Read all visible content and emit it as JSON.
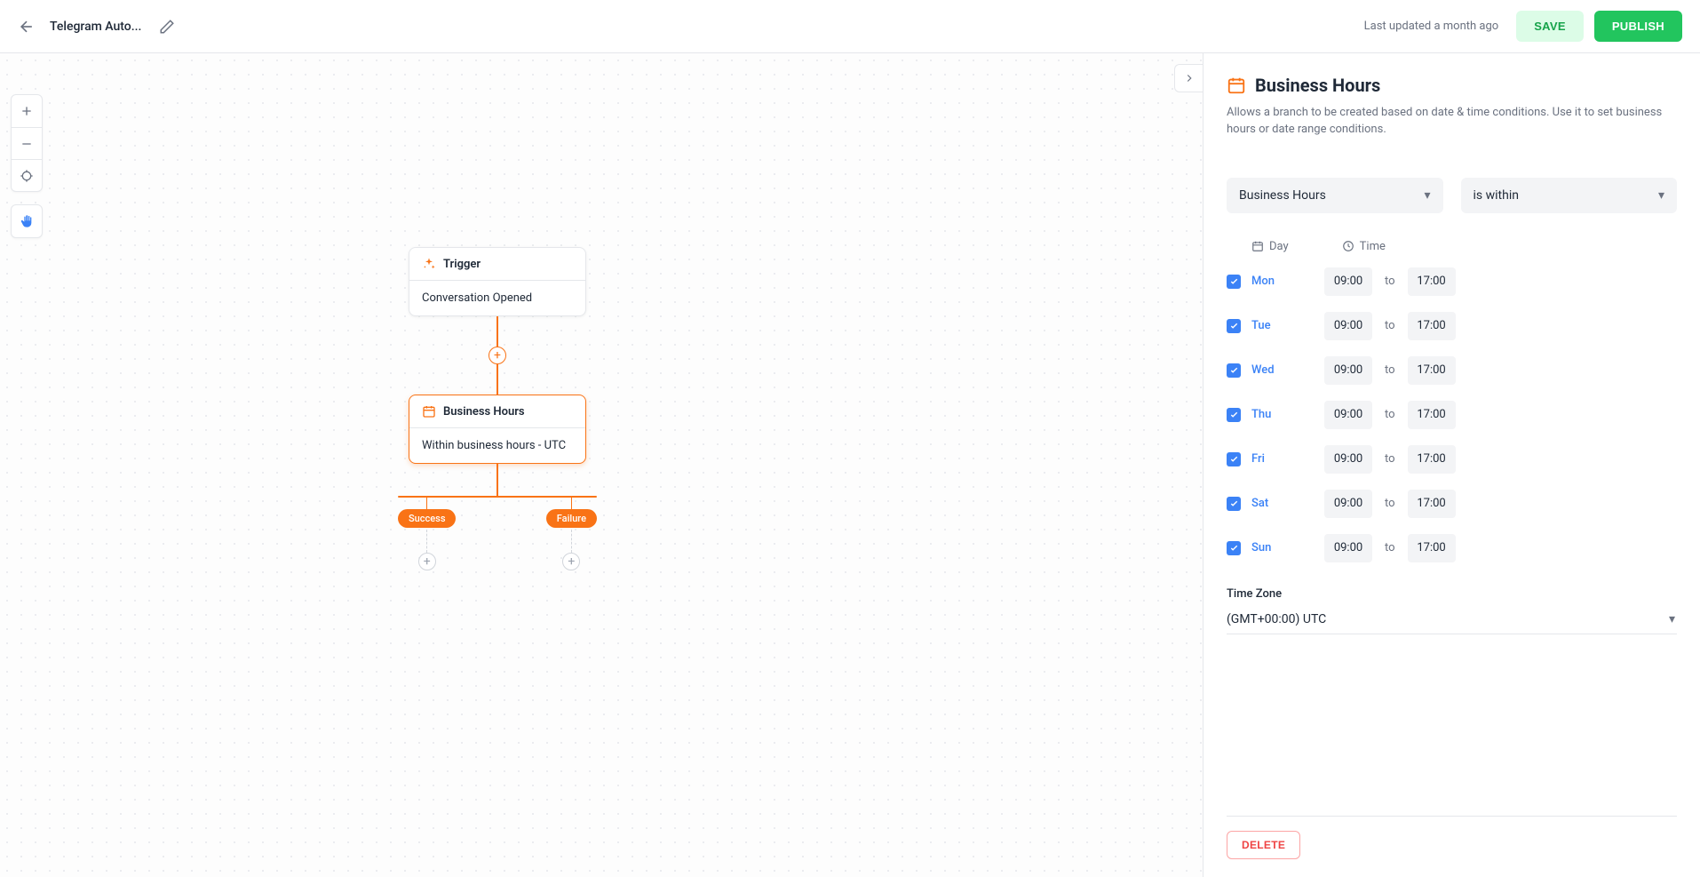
{
  "header": {
    "title": "Telegram Auto...",
    "last_updated": "Last updated a month ago",
    "save_label": "SAVE",
    "publish_label": "PUBLISH"
  },
  "flow": {
    "trigger": {
      "title": "Trigger",
      "body": "Conversation Opened"
    },
    "business_hours": {
      "title": "Business Hours",
      "body": "Within business hours - UTC"
    },
    "branch_success": "Success",
    "branch_failure": "Failure"
  },
  "panel": {
    "title": "Business Hours",
    "description": "Allows a branch to be created based on date & time conditions. Use it to set business hours or date range conditions.",
    "select_type": "Business Hours",
    "select_condition": "is within",
    "col_day": "Day",
    "col_time": "Time",
    "to_word": "to",
    "days": [
      {
        "label": "Mon",
        "checked": true,
        "start": "09:00",
        "end": "17:00"
      },
      {
        "label": "Tue",
        "checked": true,
        "start": "09:00",
        "end": "17:00"
      },
      {
        "label": "Wed",
        "checked": true,
        "start": "09:00",
        "end": "17:00"
      },
      {
        "label": "Thu",
        "checked": true,
        "start": "09:00",
        "end": "17:00"
      },
      {
        "label": "Fri",
        "checked": true,
        "start": "09:00",
        "end": "17:00"
      },
      {
        "label": "Sat",
        "checked": true,
        "start": "09:00",
        "end": "17:00"
      },
      {
        "label": "Sun",
        "checked": true,
        "start": "09:00",
        "end": "17:00"
      }
    ],
    "timezone_label": "Time Zone",
    "timezone_value": "(GMT+00:00) UTC",
    "delete_label": "DELETE"
  }
}
